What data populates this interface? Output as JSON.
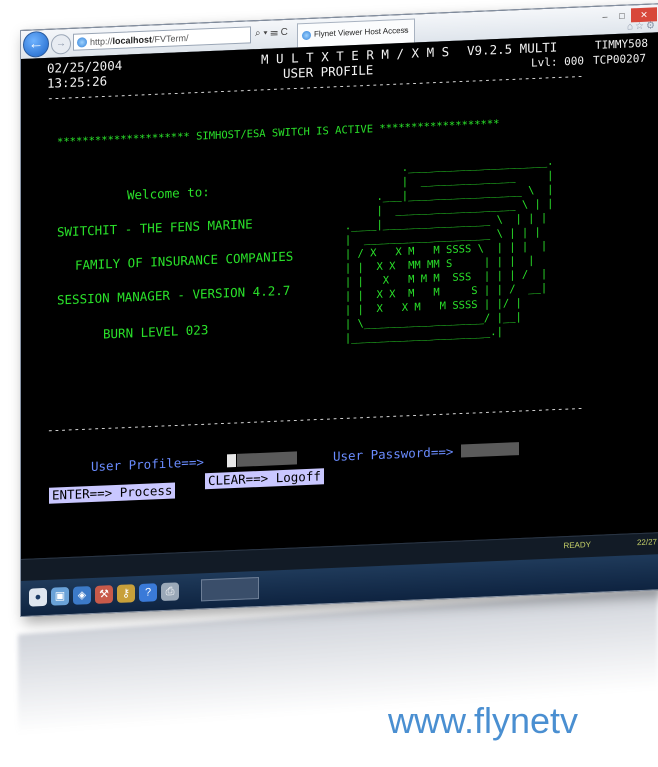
{
  "browser": {
    "address_prefix": "http://",
    "address_host": "localhost",
    "address_path": "/FVTerm/",
    "address_controls": "⌕ ▾ ☰ C",
    "tab_title": "Flynet Viewer Host Access",
    "tab_close": "×",
    "window_buttons": [
      "–",
      "□",
      "✕"
    ],
    "toolbar_icons": "⌂☆⚙"
  },
  "terminal": {
    "date": "02/25/2004",
    "time": "13:25:26",
    "app_name": "M U L T X T E R M / X M S",
    "version": "V9.2.5 MULTI",
    "user_id": "TIMMY508",
    "screen_title": "USER PROFILE",
    "level": "Lvl: 000",
    "terminal_id": "TCP00207",
    "separator": "---------------------------------------------------------------------------------",
    "banner": "********************* SIMHOST/ESA SWITCH IS ACTIVE *******************",
    "welcome_lines": [
      "Welcome to:",
      "SWITCHIT - THE FENS MARINE",
      "FAMILY OF INSURANCE COMPANIES",
      "SESSION MANAGER - VERSION 4.2.7",
      "BURN LEVEL 023"
    ],
    "logo_art": [
      "                     .______________________.",
      "                     |  _______________     |",
      "                 .___|__________________ \\  |",
      "                 |  ___________________ \\ | |",
      "            .____|_________________ \\  | | |",
      "            |  ____________________ \\ | | |",
      "            | / X   X M   M SSSS \\  | | |  |",
      "            | |  X X  MM MM S     | | |  |",
      "            | |   X   M M M  SSS  | | | /  |",
      "            | |  X X  M   M     S | | /  __|",
      "            | |  X   X M   M SSSS | |/ |",
      "            | \\___________________/ |__|",
      "            |______________________.|"
    ],
    "profile_label": "User Profile==>",
    "password_label": "User Password==>",
    "enter_key": "ENTER==> Process",
    "clear_key": "CLEAR==> Logoff",
    "ready_status": "READY",
    "cursor_position": "22/27"
  },
  "brand_url": "www.flynetv",
  "colors": {
    "terminal_bg": "#000000",
    "terminal_green": "#2ae12a",
    "terminal_blue": "#6a8cff",
    "fkey_bg": "#c9c7ff",
    "brand": "#4a8fd1"
  }
}
